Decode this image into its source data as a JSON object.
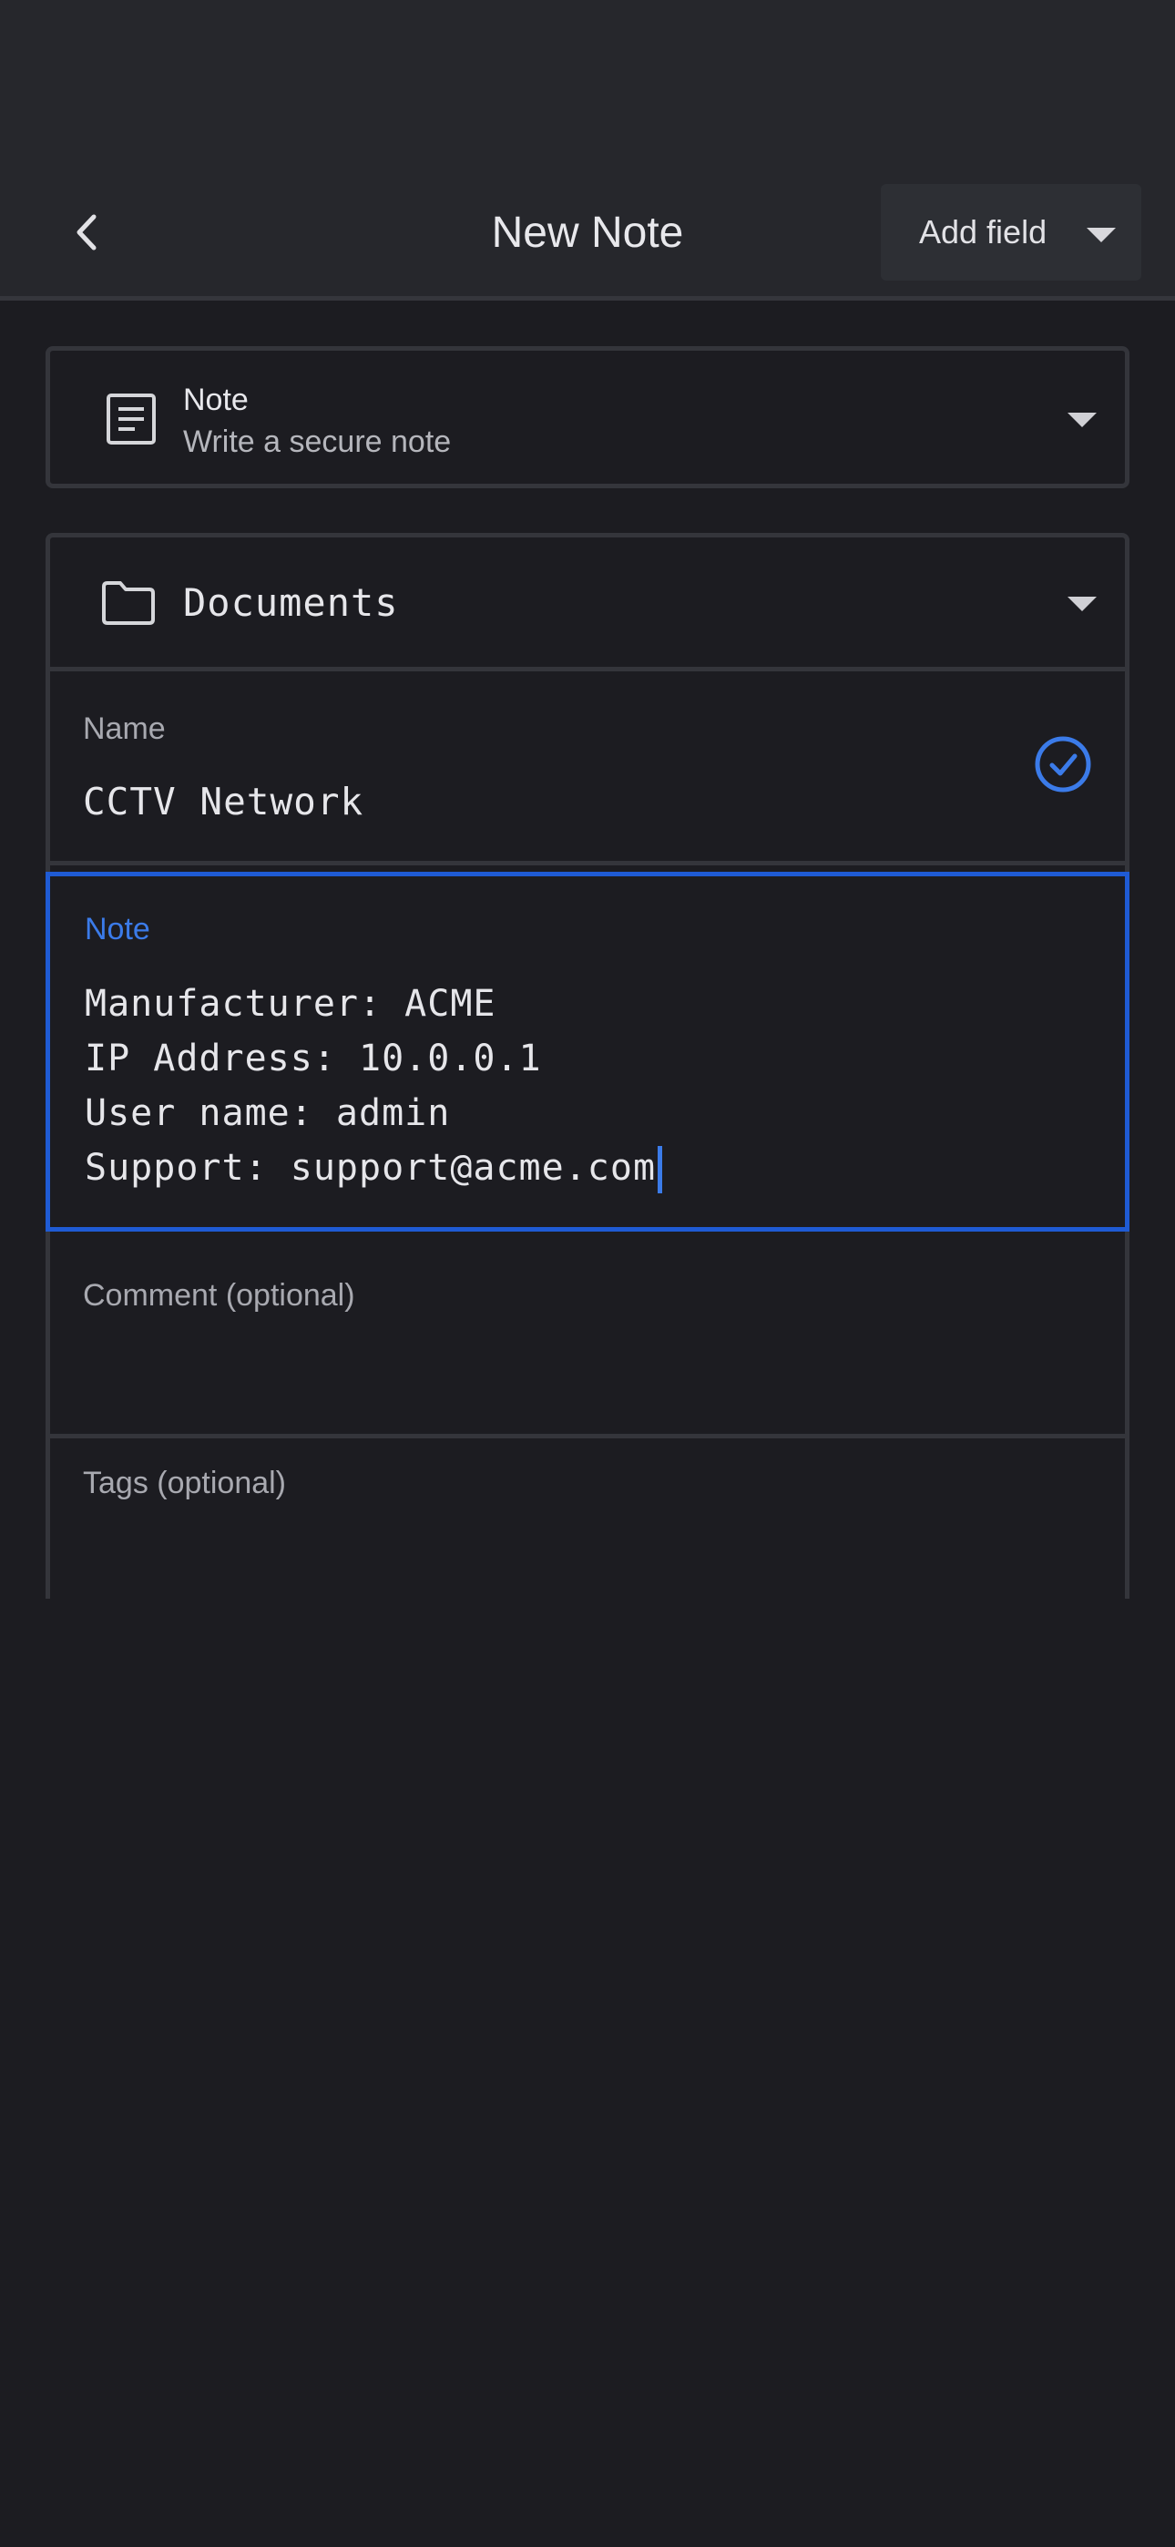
{
  "header": {
    "title": "New Note",
    "back_icon": "chevron-left-icon",
    "add_field_label": "Add field"
  },
  "item_type": {
    "title": "Note",
    "subtitle": "Write a secure note",
    "icon": "document-lines-icon"
  },
  "folder": {
    "label": "Documents",
    "icon": "folder-icon"
  },
  "fields": {
    "name": {
      "label": "Name",
      "value": "CCTV Network",
      "status_icon": "check-circle-icon"
    },
    "note": {
      "label": "Note",
      "lines": [
        "Manufacturer: ACME",
        "IP Address: 10.0.0.1",
        "User name: admin",
        "Support: support@acme.com"
      ]
    },
    "comment": {
      "label": "Comment (optional)",
      "value": ""
    },
    "tags": {
      "label": "Tags (optional)",
      "value": ""
    }
  },
  "colors": {
    "background": "#1c1c21",
    "app_bar": "#26272c",
    "accent": "#3b7be9",
    "focus_border": "#1f5bd4"
  }
}
